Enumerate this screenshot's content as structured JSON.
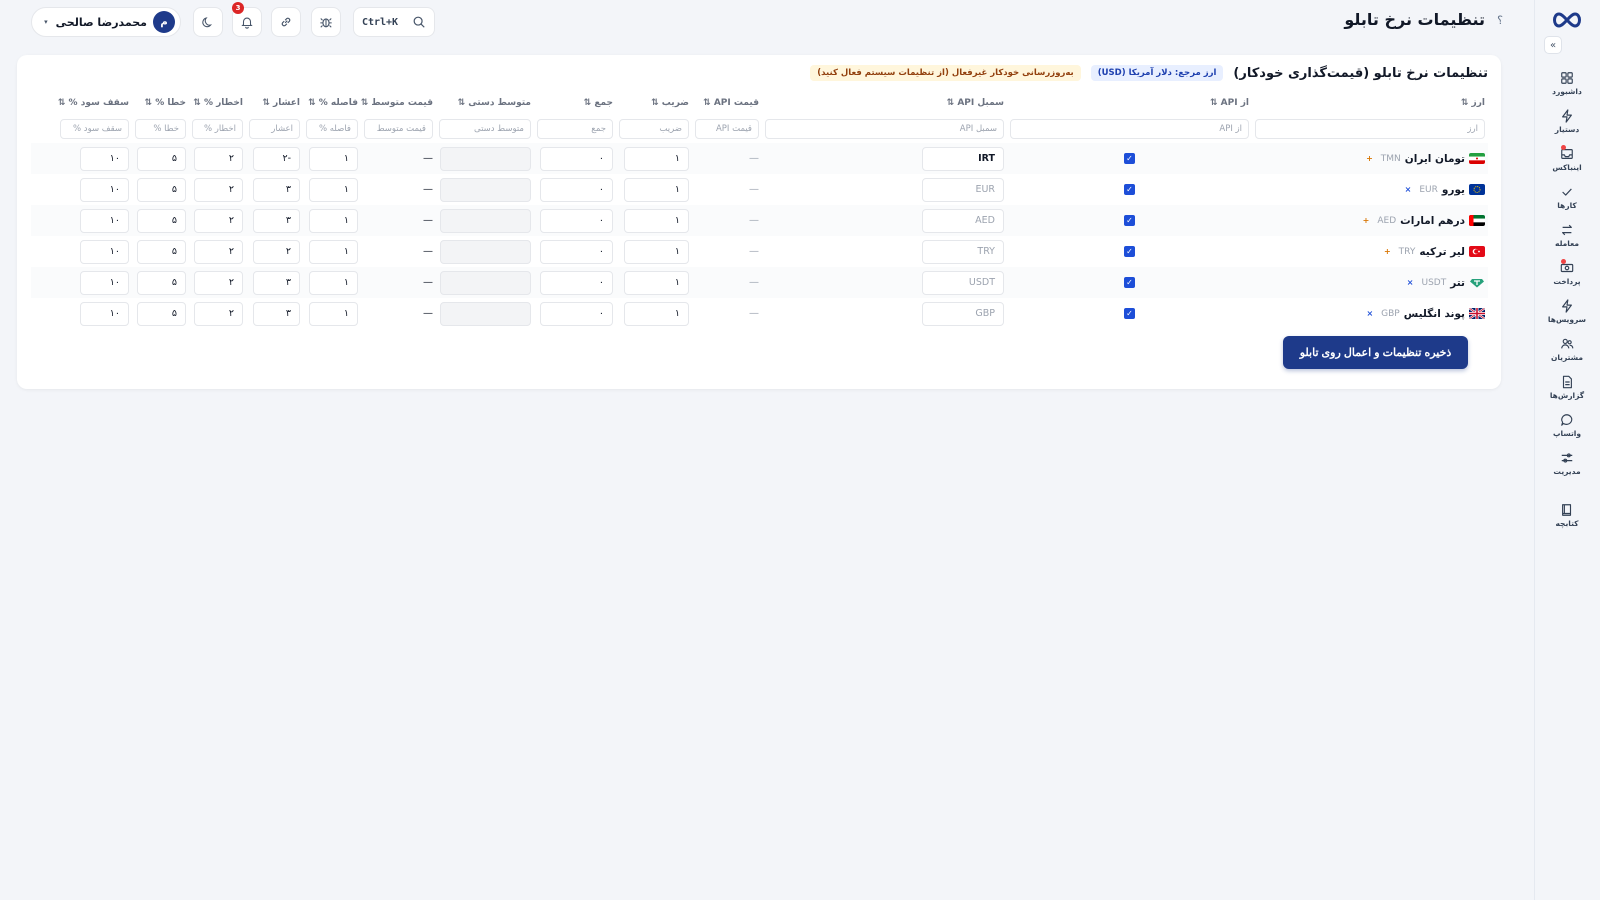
{
  "header": {
    "title": "تنظیمات نرخ تابلو",
    "help": "؟",
    "search_shortcut": "Ctrl+K",
    "notifications_count": "3",
    "user": {
      "avatar_initial": "م",
      "name": "محمدرضا صالحی",
      "caret": "▾"
    }
  },
  "sidebar": {
    "collapse": "«",
    "items": [
      {
        "label": "داشبورد",
        "icon": "dashboard-icon"
      },
      {
        "label": "دستیار",
        "icon": "bolt-icon"
      },
      {
        "label": "اینباکس",
        "icon": "inbox-icon"
      },
      {
        "label": "کارها",
        "icon": "check-icon"
      },
      {
        "label": "معامله",
        "icon": "exchange-icon"
      },
      {
        "label": "پرداخت",
        "icon": "payment-icon"
      },
      {
        "label": "سرویس‌ها",
        "icon": "services-icon"
      },
      {
        "label": "مشتریان",
        "icon": "users-icon"
      },
      {
        "label": "گزارش‌ها",
        "icon": "report-icon"
      },
      {
        "label": "واتساپ",
        "icon": "chat-icon"
      },
      {
        "label": "مدیریت",
        "icon": "sliders-icon"
      },
      {
        "label": "کتابچه",
        "icon": "book-icon"
      }
    ]
  },
  "card": {
    "title": "تنظیمات نرخ تابلو (قیمت‌گذاری خودکار)",
    "ref_currency": "ارز مرجع: دلار آمریکا (USD)",
    "auto_update_notice": "به‌روزرسانی خودکار غیرفعال (از تنظیمات سیستم فعال کنید)",
    "save_label": "ذخیره تنظیمات و اعمال روی تابلو"
  },
  "table": {
    "headers": {
      "currency": "ارز ⇅",
      "from_api": "از API ⇅",
      "api_symbol": "سمبل API ⇅",
      "api_price": "قیمت API ⇅",
      "multiplier": "ضریب ⇅",
      "sum": "جمع ⇅",
      "manual_avg": "متوسط دستی ⇅",
      "avg_price": "قیمت متوسط ⇅",
      "gap_pct": "فاصله % ⇅",
      "decimals": "اعشار ⇅",
      "warning_pct": "اخطار % ⇅",
      "error_pct": "خطا % ⇅",
      "profit_cap_pct": "سقف سود % ⇅"
    },
    "filters": {
      "currency": "ارز",
      "from_api": "از API",
      "api_symbol": "سمبل API",
      "api_price": "قیمت API",
      "multiplier": "ضریب",
      "sum": "جمع",
      "manual_avg": "متوسط دستی",
      "avg_price": "قیمت متوسط",
      "gap_pct": "فاصله %",
      "decimals": "اعشار",
      "warning_pct": "اخطار %",
      "error_pct": "خطا %",
      "profit_cap_pct": "سقف سود %"
    },
    "rows": [
      {
        "name": "تومان ایران",
        "code": "TMN",
        "mark": "+",
        "flag": "ir",
        "from_api": true,
        "symbol": "IRT",
        "symbol_active": true,
        "api_price": "—",
        "multiplier": "۱",
        "sum": "۰",
        "manual_avg": "",
        "avg_price": "—",
        "gap": "۱",
        "decimals": "-۲",
        "warning": "۲",
        "error": "۵",
        "cap": "۱۰"
      },
      {
        "name": "یورو",
        "code": "EUR",
        "mark": "×",
        "flag": "eu",
        "from_api": true,
        "symbol": "EUR",
        "symbol_active": false,
        "api_price": "—",
        "multiplier": "۱",
        "sum": "۰",
        "manual_avg": "",
        "avg_price": "—",
        "gap": "۱",
        "decimals": "۳",
        "warning": "۲",
        "error": "۵",
        "cap": "۱۰"
      },
      {
        "name": "درهم امارات",
        "code": "AED",
        "mark": "+",
        "flag": "ae",
        "from_api": true,
        "symbol": "AED",
        "symbol_active": false,
        "api_price": "—",
        "multiplier": "۱",
        "sum": "۰",
        "manual_avg": "",
        "avg_price": "—",
        "gap": "۱",
        "decimals": "۳",
        "warning": "۲",
        "error": "۵",
        "cap": "۱۰"
      },
      {
        "name": "لیر ترکیه",
        "code": "TRY",
        "mark": "+",
        "flag": "tr",
        "from_api": true,
        "symbol": "TRY",
        "symbol_active": false,
        "api_price": "—",
        "multiplier": "۱",
        "sum": "۰",
        "manual_avg": "",
        "avg_price": "—",
        "gap": "۱",
        "decimals": "۲",
        "warning": "۲",
        "error": "۵",
        "cap": "۱۰"
      },
      {
        "name": "تتر",
        "code": "USDT",
        "mark": "×",
        "flag": "usdt",
        "from_api": true,
        "symbol": "USDT",
        "symbol_active": false,
        "api_price": "—",
        "multiplier": "۱",
        "sum": "۰",
        "manual_avg": "",
        "avg_price": "—",
        "gap": "۱",
        "decimals": "۳",
        "warning": "۲",
        "error": "۵",
        "cap": "۱۰"
      },
      {
        "name": "پوند انگلیس",
        "code": "GBP",
        "mark": "×",
        "flag": "gb",
        "from_api": true,
        "symbol": "GBP",
        "symbol_active": false,
        "api_price": "—",
        "multiplier": "۱",
        "sum": "۰",
        "manual_avg": "",
        "avg_price": "—",
        "gap": "۱",
        "decimals": "۳",
        "warning": "۲",
        "error": "۵",
        "cap": "۱۰"
      }
    ]
  },
  "colors": {
    "primary": "#1e3a8a",
    "checkbox": "#1d4ed8",
    "badge": "#dc2626",
    "plus_mark": "#d97706",
    "x_mark": "#1d4ed8"
  }
}
